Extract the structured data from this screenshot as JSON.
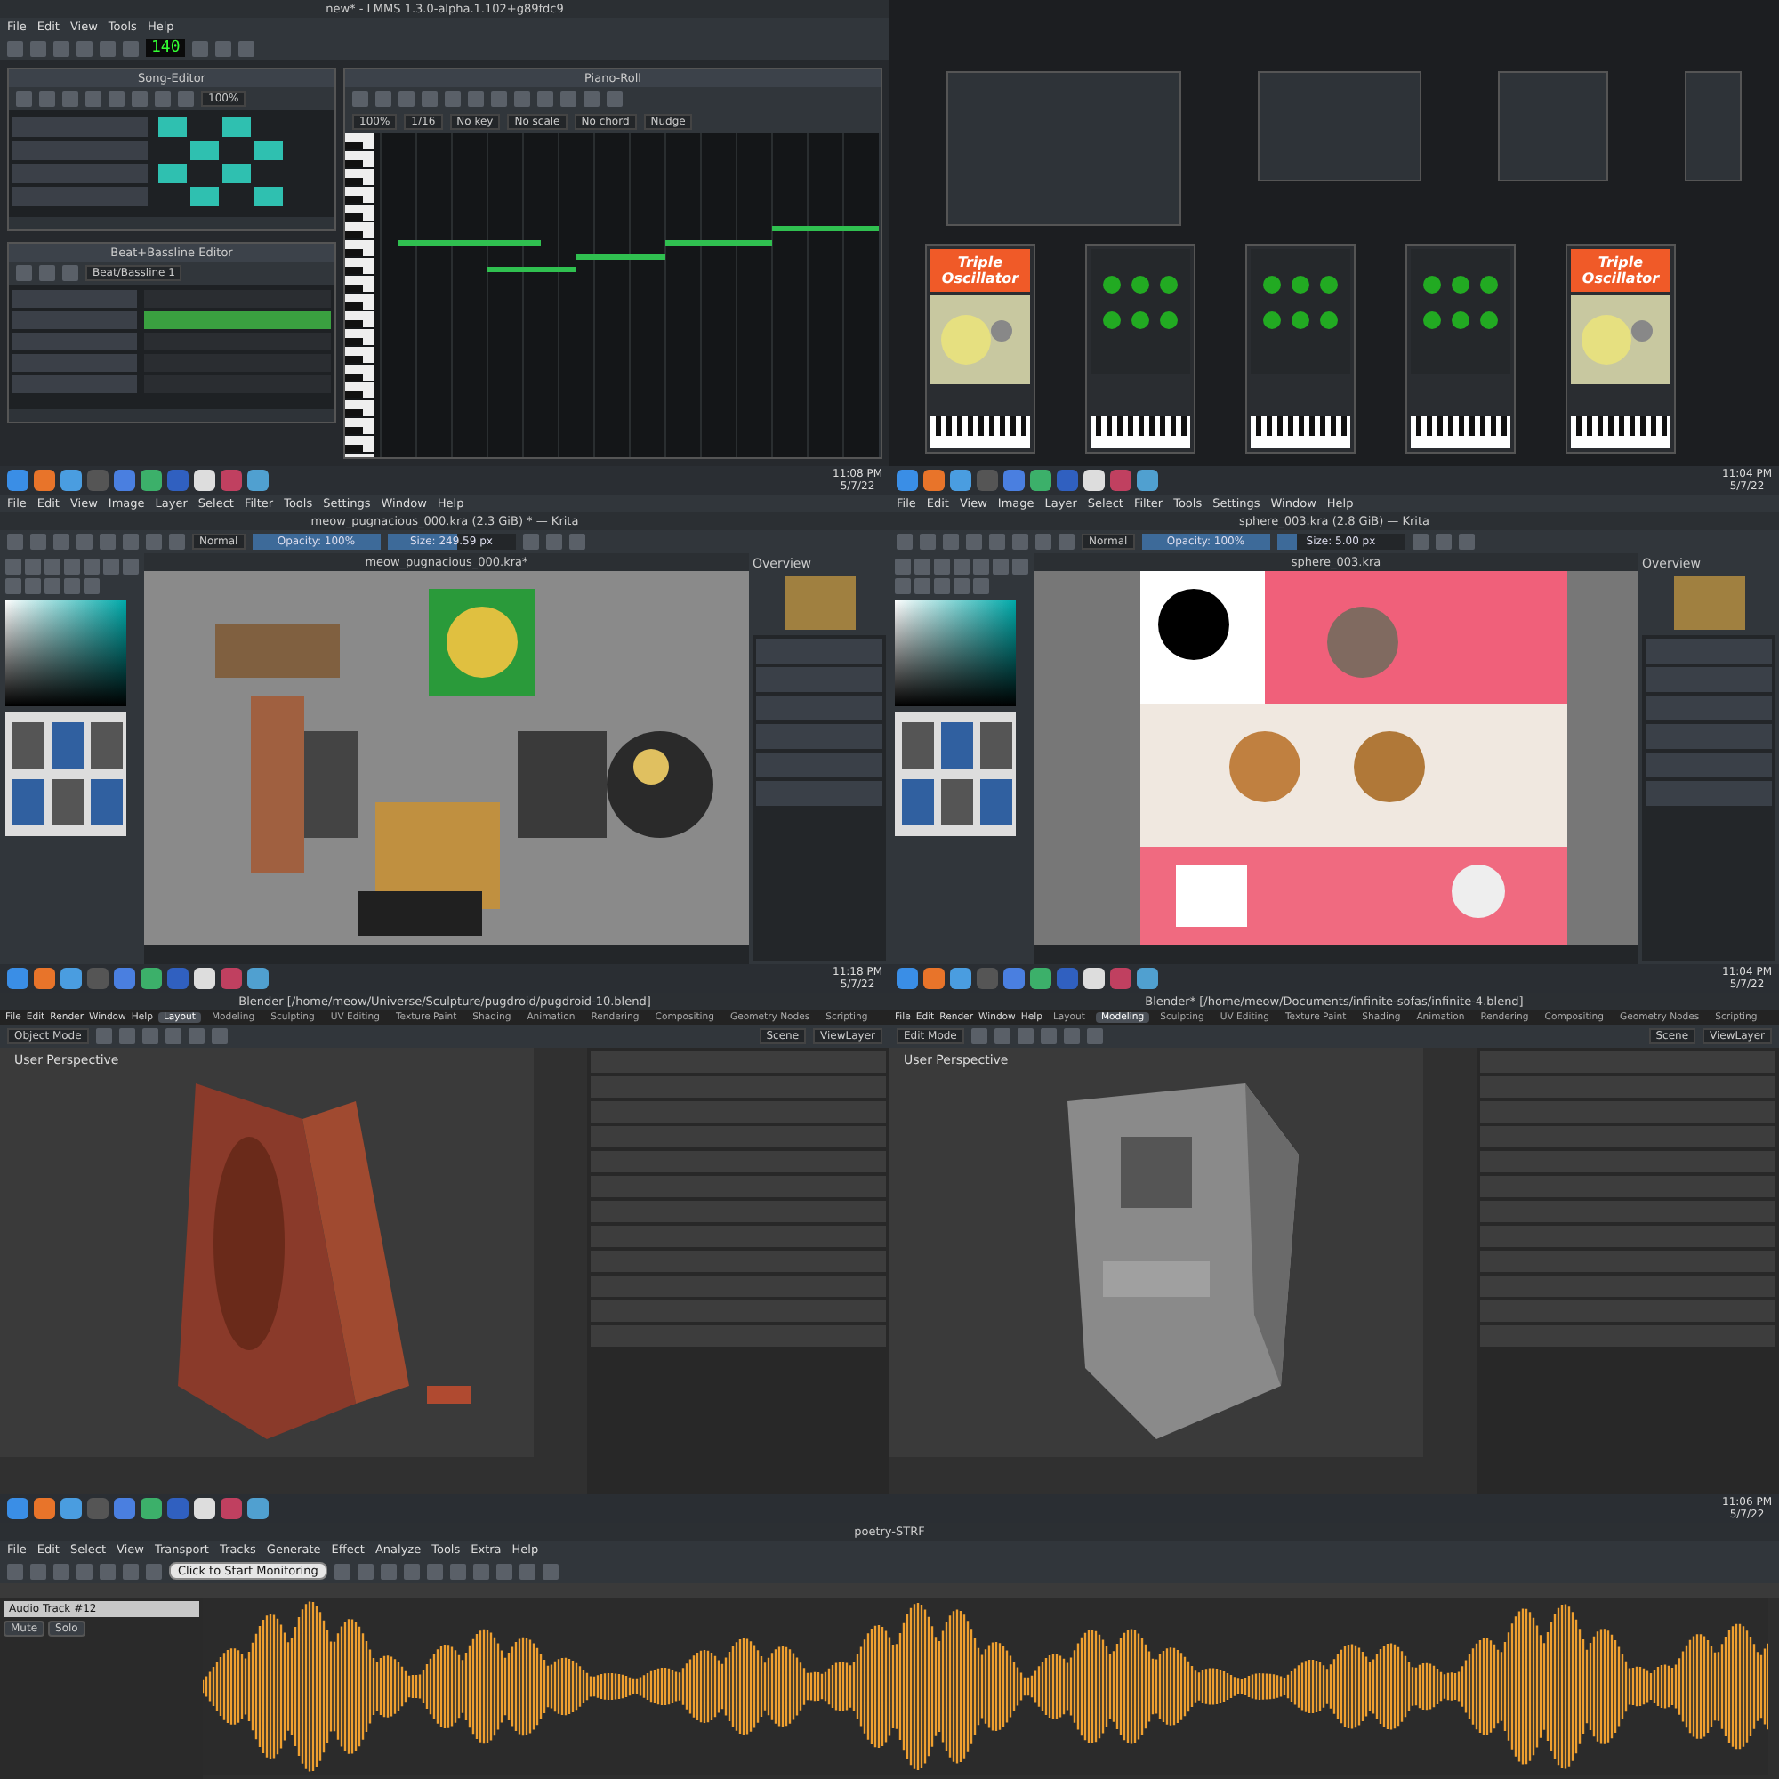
{
  "lmms": {
    "title": "new* - LMMS 1.3.0-alpha.1.102+g89fdc9",
    "menu": [
      "File",
      "Edit",
      "View",
      "Tools",
      "Help"
    ],
    "tempo": "140",
    "song_editor": {
      "title": "Song-Editor",
      "zoom": "100%"
    },
    "piano_roll": {
      "title": "Piano-Roll",
      "zoom": "100%",
      "quantize": "1/16",
      "no_key": "No key",
      "no_scale": "No scale",
      "no_chord": "No chord",
      "nudge": "Nudge"
    },
    "beat_editor": {
      "title": "Beat+Bassline Editor",
      "pattern": "Beat/Bassline 1"
    },
    "plugins": [
      {
        "kind": "triple",
        "banner": "Triple Oscillator"
      },
      {
        "kind": "generic"
      },
      {
        "kind": "generic"
      },
      {
        "kind": "generic"
      },
      {
        "kind": "triple",
        "banner": "Triple Oscillator"
      }
    ]
  },
  "krita": [
    {
      "title": "meow_pugnacious_000.kra (2.3 GiB) * — Krita",
      "menu": [
        "File",
        "Edit",
        "View",
        "Image",
        "Layer",
        "Select",
        "Filter",
        "Tools",
        "Settings",
        "Window",
        "Help"
      ],
      "blend": "Normal",
      "opacity": {
        "text": "Opacity: 100%",
        "level": 1
      },
      "size": {
        "text": "Size: 249.59 px",
        "level": 0.55
      },
      "tab": "meow_pugnacious_000.kra*",
      "docker": "Overview",
      "clock": "11:08 PM",
      "date": "5/7/22"
    },
    {
      "title": "sphere_003.kra (2.8 GiB) — Krita",
      "menu": [
        "File",
        "Edit",
        "View",
        "Image",
        "Layer",
        "Select",
        "Filter",
        "Tools",
        "Settings",
        "Window",
        "Help"
      ],
      "blend": "Normal",
      "opacity": {
        "text": "Opacity: 100%",
        "level": 1
      },
      "size": {
        "text": "Size: 5.00 px",
        "level": 0.15
      },
      "tab": "sphere_003.kra",
      "docker": "Overview",
      "clock": "11:04 PM",
      "date": "5/7/22"
    }
  ],
  "blender": [
    {
      "title": "Blender [/home/meow/Universe/Sculpture/pugdroid/pugdroid-10.blend]",
      "menu": [
        "File",
        "Edit",
        "Render",
        "Window",
        "Help"
      ],
      "workspaces": [
        {
          "label": "Layout",
          "selected": true
        },
        {
          "label": "Modeling",
          "selected": false
        },
        {
          "label": "Sculpting",
          "selected": false
        },
        {
          "label": "UV Editing",
          "selected": false
        },
        {
          "label": "Texture Paint",
          "selected": false
        },
        {
          "label": "Shading",
          "selected": false
        },
        {
          "label": "Animation",
          "selected": false
        },
        {
          "label": "Rendering",
          "selected": false
        },
        {
          "label": "Compositing",
          "selected": false
        },
        {
          "label": "Geometry Nodes",
          "selected": false
        },
        {
          "label": "Scripting",
          "selected": false
        }
      ],
      "mode": "Object Mode",
      "scene": "Scene",
      "view_layer": "ViewLayer",
      "viewport_label": "User Perspective",
      "clock": "11:18 PM",
      "date": "5/7/22"
    },
    {
      "title": "Blender* [/home/meow/Documents/infinite-sofas/infinite-4.blend]",
      "menu": [
        "File",
        "Edit",
        "Render",
        "Window",
        "Help"
      ],
      "workspaces": [
        {
          "label": "Layout",
          "selected": false
        },
        {
          "label": "Modeling",
          "selected": true
        },
        {
          "label": "Sculpting",
          "selected": false
        },
        {
          "label": "UV Editing",
          "selected": false
        },
        {
          "label": "Texture Paint",
          "selected": false
        },
        {
          "label": "Shading",
          "selected": false
        },
        {
          "label": "Animation",
          "selected": false
        },
        {
          "label": "Rendering",
          "selected": false
        },
        {
          "label": "Compositing",
          "selected": false
        },
        {
          "label": "Geometry Nodes",
          "selected": false
        },
        {
          "label": "Scripting",
          "selected": false
        }
      ],
      "mode": "Edit Mode",
      "scene": "Scene",
      "view_layer": "ViewLayer",
      "viewport_label": "User Perspective",
      "clock": "11:04 PM",
      "date": "5/7/22"
    }
  ],
  "audacity": {
    "title": "poetry-STRF",
    "menu": [
      "File",
      "Edit",
      "Select",
      "View",
      "Transport",
      "Tracks",
      "Generate",
      "Effect",
      "Analyze",
      "Tools",
      "Extra",
      "Help"
    ],
    "monitor": "Click to Start Monitoring",
    "track": {
      "name": "Audio Track #12",
      "mute": "Mute",
      "solo": "Solo"
    },
    "clock": "11:06 PM",
    "date": "5/7/22"
  }
}
